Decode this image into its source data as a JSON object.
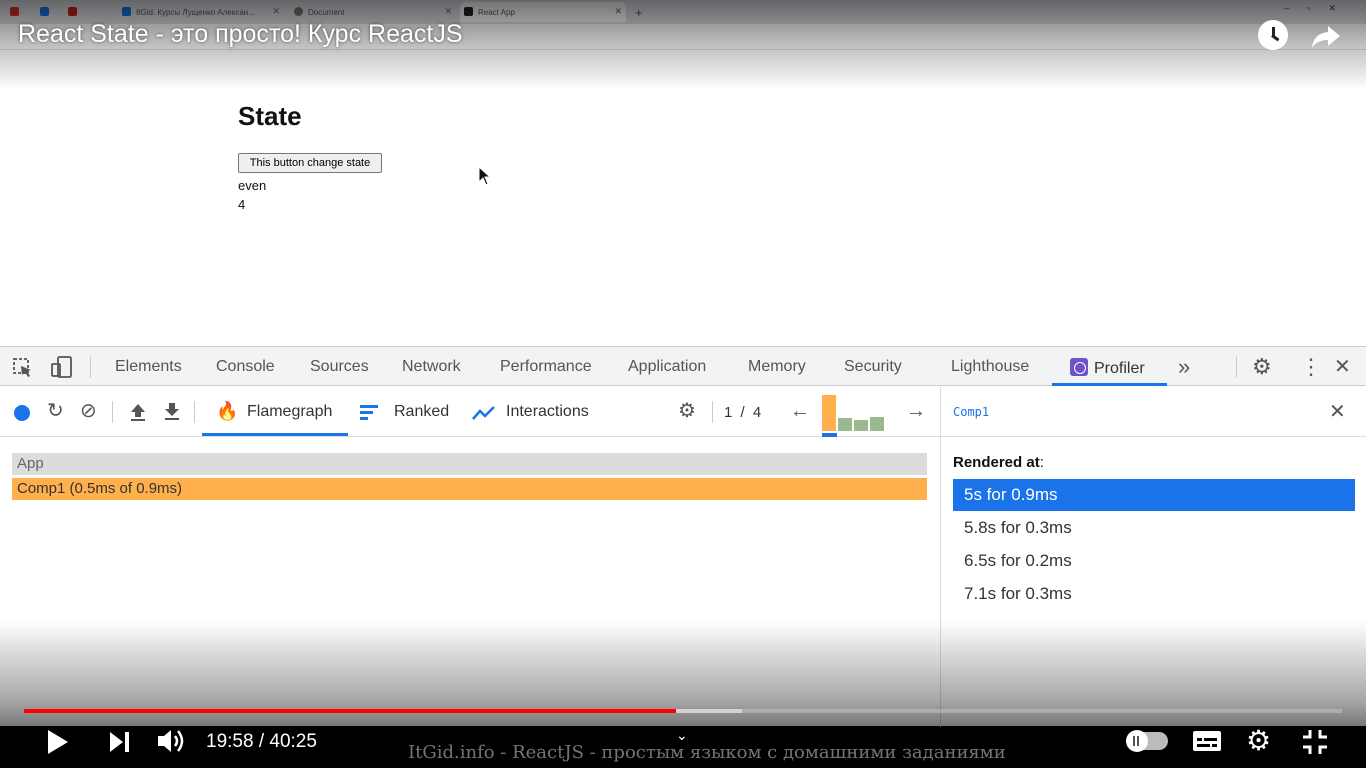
{
  "browser": {
    "tabs": [
      {
        "label": "",
        "color": "#d93025"
      },
      {
        "label": "",
        "color": "#1a73e8"
      },
      {
        "label": "",
        "color": "#c5221f"
      },
      {
        "label": "ItGid. Курсы Лущенко Алексан...",
        "color": "#1a73e8"
      },
      {
        "label": "Document",
        "color": "#777777"
      },
      {
        "label": "React App",
        "color": "#20232a"
      }
    ]
  },
  "video": {
    "title": "React State - это просто! Курс ReactJS",
    "time": "19:58 / 40:25",
    "watermark": "ItGid.info - ReactJS - простым языком с домашними заданиями",
    "progress_played": 0.495,
    "progress_buffered": 0.545
  },
  "page": {
    "title": "State",
    "button_label": "This button change state",
    "parity": "even",
    "count": "4"
  },
  "devtools": {
    "tabs": [
      "Elements",
      "Console",
      "Sources",
      "Network",
      "Performance",
      "Application",
      "Memory",
      "Security",
      "Lighthouse",
      "Profiler"
    ],
    "active_tab": "Profiler",
    "profiler": {
      "views": [
        "Flamegraph",
        "Ranked",
        "Interactions"
      ],
      "active_view": "Flamegraph",
      "commit_index": "1",
      "commit_sep": "/",
      "commit_total": "4",
      "commit_bar_heights": [
        1.0,
        0.35,
        0.3,
        0.38
      ],
      "commit_bar_colors": [
        "#ffb04d",
        "#9bb98f",
        "#9bb98f",
        "#9bb98f"
      ],
      "flame": {
        "root": "App",
        "child": "Comp1 (0.5ms of 0.9ms)"
      },
      "side": {
        "component": "Comp1",
        "rendered_at_label": "Rendered at",
        "renders": [
          "5s for 0.9ms",
          "5.8s for 0.3ms",
          "6.5s for 0.2ms",
          "7.1s for 0.3ms"
        ],
        "selected": 0
      }
    }
  },
  "colors": {
    "accent": "#1a73e8",
    "flame_comp": "#ffb04d",
    "progress_red": "#ff0000"
  }
}
